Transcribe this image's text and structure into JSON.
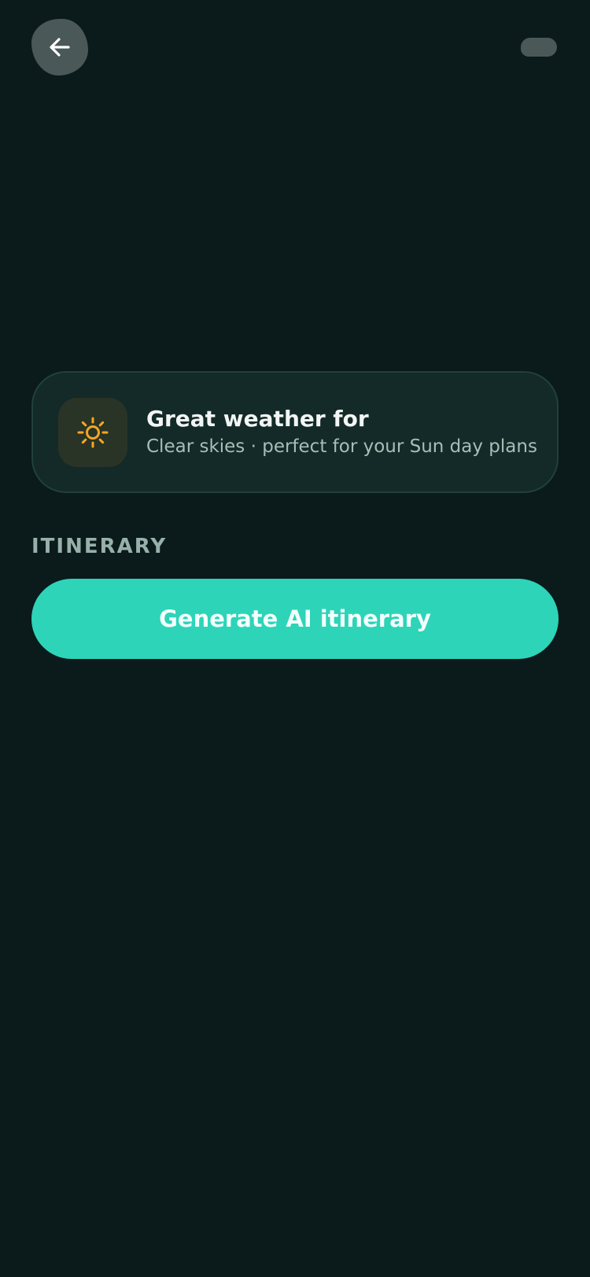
{
  "header": {
    "back_icon": "arrow-left-icon"
  },
  "weather_card": {
    "icon": "sun-icon",
    "icon_color": "#f5a623",
    "title": "Great weather for",
    "subtitle": "Clear skies · perfect for your Sun day plans"
  },
  "itinerary": {
    "section_label": "ITINERARY",
    "generate_label": "Generate AI itinerary",
    "accent_color": "#2dd4b8"
  }
}
